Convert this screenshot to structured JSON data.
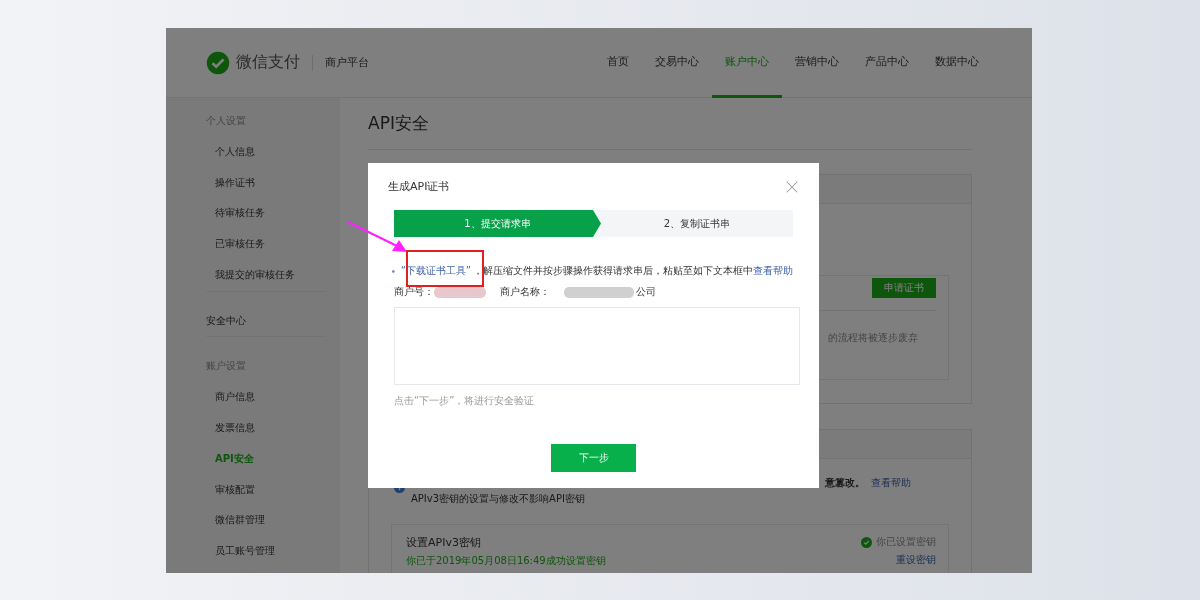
{
  "header": {
    "logo_text": "微信支付",
    "platform": "商户平台",
    "nav": [
      {
        "label": "首页",
        "selected": false
      },
      {
        "label": "交易中心",
        "selected": false
      },
      {
        "label": "账户中心",
        "selected": true
      },
      {
        "label": "营销中心",
        "selected": false
      },
      {
        "label": "产品中心",
        "selected": false
      },
      {
        "label": "数据中心",
        "selected": false
      }
    ]
  },
  "sidebar": {
    "sections": [
      {
        "kind": "group",
        "title": "个人设置",
        "items": [
          {
            "label": "个人信息",
            "selected": false
          },
          {
            "label": "操作证书",
            "selected": false
          },
          {
            "label": "待审核任务",
            "selected": false
          },
          {
            "label": "已审核任务",
            "selected": false
          },
          {
            "label": "我提交的审核任务",
            "selected": false
          }
        ]
      },
      {
        "kind": "link",
        "title": "安全中心"
      },
      {
        "kind": "group",
        "title": "账户设置",
        "items": [
          {
            "label": "商户信息",
            "selected": false
          },
          {
            "label": "发票信息",
            "selected": false
          },
          {
            "label": "API安全",
            "selected": true
          },
          {
            "label": "审核配置",
            "selected": false
          },
          {
            "label": "微信群管理",
            "selected": false
          },
          {
            "label": "员工账号管理",
            "selected": false
          }
        ]
      }
    ]
  },
  "page": {
    "title": "API安全",
    "api_cert_card": {
      "apply_button": "申请证书",
      "note_fragment": "的流程将被逐步废弃"
    },
    "apiv3_card": {
      "notice_fragment": "意篡改。",
      "help_link": "查看帮助",
      "notice_line2": "APIv3密钥的设置与修改不影响API密钥",
      "key_title": "设置APIv3密钥",
      "key_set_time": "你已于2019年05月08日16:49成功设置密钥",
      "status": "你已设置密钥",
      "reset_link": "重设密钥"
    }
  },
  "dialog": {
    "title": "生成API证书",
    "steps": [
      {
        "label": "1、提交请求串",
        "selected": true
      },
      {
        "label": "2、复制证书串",
        "selected": false
      }
    ],
    "info": {
      "link": "“下载证书工具”",
      "text": "，解压缩文件并按步骤操作获得请求串后，粘贴至如下文本框中",
      "help_link": "查看帮助"
    },
    "merchant_id_label": "商户号：",
    "merchant_name_label": "商户名称：",
    "merchant_name_tail": "公司",
    "hint": "点击“下一步”，将进行安全验证",
    "next_button": "下一步"
  }
}
